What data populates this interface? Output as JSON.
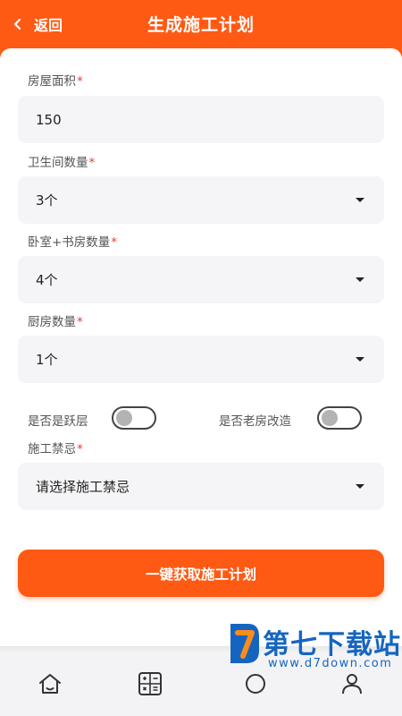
{
  "header": {
    "back_label": "返回",
    "title": "生成施工计划"
  },
  "form": {
    "house_area": {
      "label": "房屋面积",
      "required_mark": "*",
      "value": "150"
    },
    "bathrooms": {
      "label": "卫生间数量",
      "required_mark": "*",
      "value": "3个"
    },
    "bedrooms": {
      "label": "卧室+书房数量",
      "required_mark": "*",
      "value": "4个"
    },
    "kitchens": {
      "label": "厨房数量",
      "required_mark": "*",
      "value": "1个"
    },
    "duplex": {
      "label": "是否是跃层",
      "on": false
    },
    "renovation": {
      "label": "是否老房改造",
      "on": false
    },
    "taboo": {
      "label": "施工禁忌",
      "required_mark": "*",
      "value": "请选择施工禁忌"
    }
  },
  "cta": {
    "label": "一键获取施工计划"
  },
  "tabbar": {
    "items": [
      {
        "icon": "home-icon"
      },
      {
        "icon": "calculator-icon"
      },
      {
        "icon": "tab-icon"
      },
      {
        "icon": "profile-icon"
      }
    ]
  },
  "watermark": {
    "name": "第七下载站",
    "url": "www.d7down.com"
  },
  "colors": {
    "accent": "#ff5a14",
    "required": "#e83b3b",
    "field_bg": "#f5f5f7",
    "brand_blue": "#1565c0"
  }
}
